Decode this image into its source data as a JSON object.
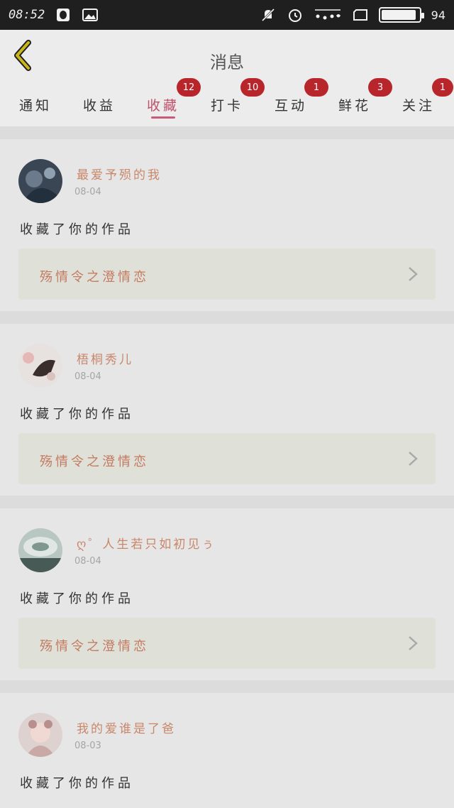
{
  "status_bar": {
    "time": "08:52",
    "battery_percent": 94,
    "battery_label": "94",
    "icons": [
      "qq-icon",
      "gallery-icon",
      "mute-icon",
      "alarm-icon",
      "signal-icon",
      "window-icon",
      "battery-icon"
    ]
  },
  "header": {
    "title": "消息"
  },
  "tabs": [
    {
      "label": "通知",
      "badge": ""
    },
    {
      "label": "收益",
      "badge": ""
    },
    {
      "label": "收藏",
      "badge": "12"
    },
    {
      "label": "打卡",
      "badge": "10"
    },
    {
      "label": "互动",
      "badge": "1"
    },
    {
      "label": "鲜花",
      "badge": "3"
    },
    {
      "label": "关注",
      "badge": "1"
    }
  ],
  "active_tab": "收藏",
  "items": [
    {
      "name": "最爱予殒的我",
      "date": "08-04",
      "action": "收藏了你的作品",
      "work_title": "殇情令之澄情恋"
    },
    {
      "name": "梧桐秀儿",
      "date": "08-04",
      "action": "收藏了你的作品",
      "work_title": "殇情令之澄情恋"
    },
    {
      "name": "ღ゜人生若只如初见ぅ",
      "date": "08-04",
      "action": "收藏了你的作品",
      "work_title": "殇情令之澄情恋"
    },
    {
      "name": "我的爱谁是了爸",
      "date": "08-03",
      "action": "收藏了你的作品",
      "work_title": ""
    }
  ],
  "colors": {
    "accent": "#c85c78",
    "badge": "#b8262b",
    "name_text": "#c9876a",
    "back_arrow": "#c9b61b"
  }
}
